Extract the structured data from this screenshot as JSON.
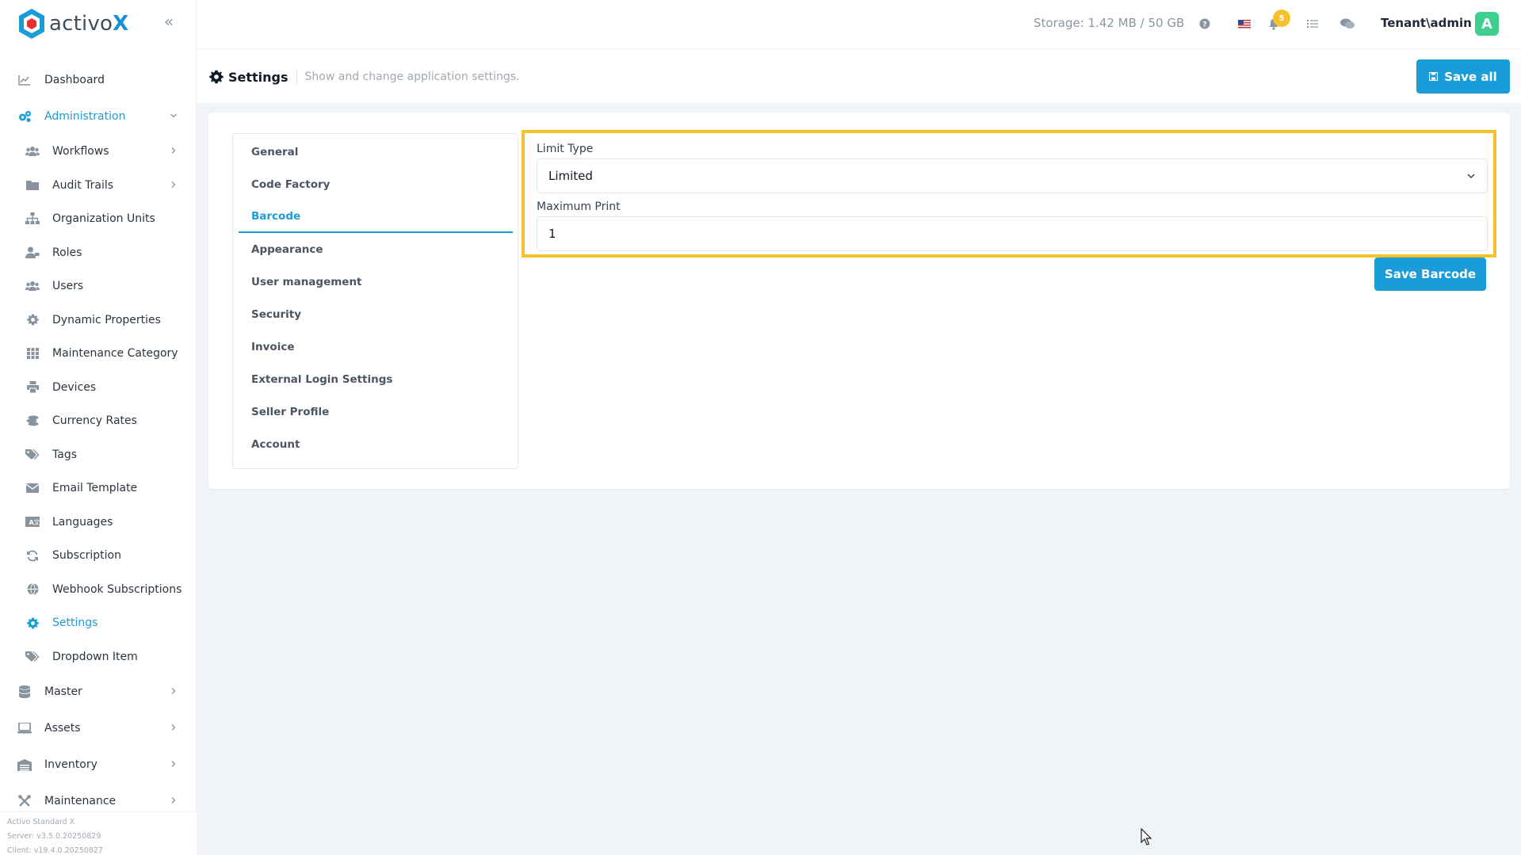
{
  "brand": {
    "name": "activo",
    "suffix": "X"
  },
  "sidebar": {
    "items": [
      {
        "label": "Dashboard",
        "icon": "chart-icon",
        "level": "top",
        "active": false,
        "chevron": ""
      },
      {
        "label": "Administration",
        "icon": "cogs-icon",
        "level": "top",
        "active": true,
        "chevron": "down"
      },
      {
        "label": "Workflows",
        "icon": "users-icon",
        "level": "sub",
        "active": false,
        "chevron": "right"
      },
      {
        "label": "Audit Trails",
        "icon": "folder-icon",
        "level": "sub",
        "active": false,
        "chevron": "right"
      },
      {
        "label": "Organization Units",
        "icon": "sitemap-icon",
        "level": "sub",
        "active": false,
        "chevron": ""
      },
      {
        "label": "Roles",
        "icon": "user-tag-icon",
        "level": "sub",
        "active": false,
        "chevron": ""
      },
      {
        "label": "Users",
        "icon": "users-icon",
        "level": "sub",
        "active": false,
        "chevron": ""
      },
      {
        "label": "Dynamic Properties",
        "icon": "gear-icon",
        "level": "sub",
        "active": false,
        "chevron": ""
      },
      {
        "label": "Maintenance Category",
        "icon": "grid-icon",
        "level": "sub",
        "active": false,
        "chevron": ""
      },
      {
        "label": "Devices",
        "icon": "printer-icon",
        "level": "sub",
        "active": false,
        "chevron": ""
      },
      {
        "label": "Currency Rates",
        "icon": "coins-icon",
        "level": "sub",
        "active": false,
        "chevron": ""
      },
      {
        "label": "Tags",
        "icon": "tags-icon",
        "level": "sub",
        "active": false,
        "chevron": ""
      },
      {
        "label": "Email Template",
        "icon": "envelope-icon",
        "level": "sub",
        "active": false,
        "chevron": ""
      },
      {
        "label": "Languages",
        "icon": "language-icon",
        "level": "sub",
        "active": false,
        "chevron": ""
      },
      {
        "label": "Subscription",
        "icon": "refresh-icon",
        "level": "sub",
        "active": false,
        "chevron": ""
      },
      {
        "label": "Webhook Subscriptions",
        "icon": "globe-icon",
        "level": "sub",
        "active": false,
        "chevron": ""
      },
      {
        "label": "Settings",
        "icon": "gear-icon",
        "level": "sub",
        "active": true,
        "chevron": ""
      },
      {
        "label": "Dropdown Item",
        "icon": "tags-icon",
        "level": "sub",
        "active": false,
        "chevron": ""
      },
      {
        "label": "Master",
        "icon": "database-icon",
        "level": "top",
        "active": false,
        "chevron": "right"
      },
      {
        "label": "Assets",
        "icon": "laptop-icon",
        "level": "top",
        "active": false,
        "chevron": "right"
      },
      {
        "label": "Inventory",
        "icon": "warehouse-icon",
        "level": "top",
        "active": false,
        "chevron": "right"
      },
      {
        "label": "Maintenance",
        "icon": "tools-icon",
        "level": "top",
        "active": false,
        "chevron": "right"
      }
    ],
    "footer": {
      "product": "Activo Standard X",
      "server": "Server: v3.5.0.20250829",
      "client": "Client: v19.4.0.20250827"
    }
  },
  "topbar": {
    "storage": "Storage: 1.42 MB / 50 GB",
    "notification_count": "5",
    "user": "Tenant\\admin",
    "avatar_letter": "A"
  },
  "subheader": {
    "title": "Settings",
    "description": "Show and change application settings.",
    "save_all_label": "Save all"
  },
  "settings_tabs": [
    {
      "label": "General",
      "active": false
    },
    {
      "label": "Code Factory",
      "active": false
    },
    {
      "label": "Barcode",
      "active": true
    },
    {
      "label": "Appearance",
      "active": false
    },
    {
      "label": "User management",
      "active": false
    },
    {
      "label": "Security",
      "active": false
    },
    {
      "label": "Invoice",
      "active": false
    },
    {
      "label": "External Login Settings",
      "active": false
    },
    {
      "label": "Seller Profile",
      "active": false
    },
    {
      "label": "Account",
      "active": false
    }
  ],
  "barcode_form": {
    "limit_type_label": "Limit Type",
    "limit_type_value": "Limited",
    "max_print_label": "Maximum Print",
    "max_print_value": "1",
    "save_label": "Save Barcode"
  },
  "colors": {
    "accent": "#1a9cd8",
    "highlight": "#f6c22b",
    "avatar": "#3ecf8e"
  }
}
